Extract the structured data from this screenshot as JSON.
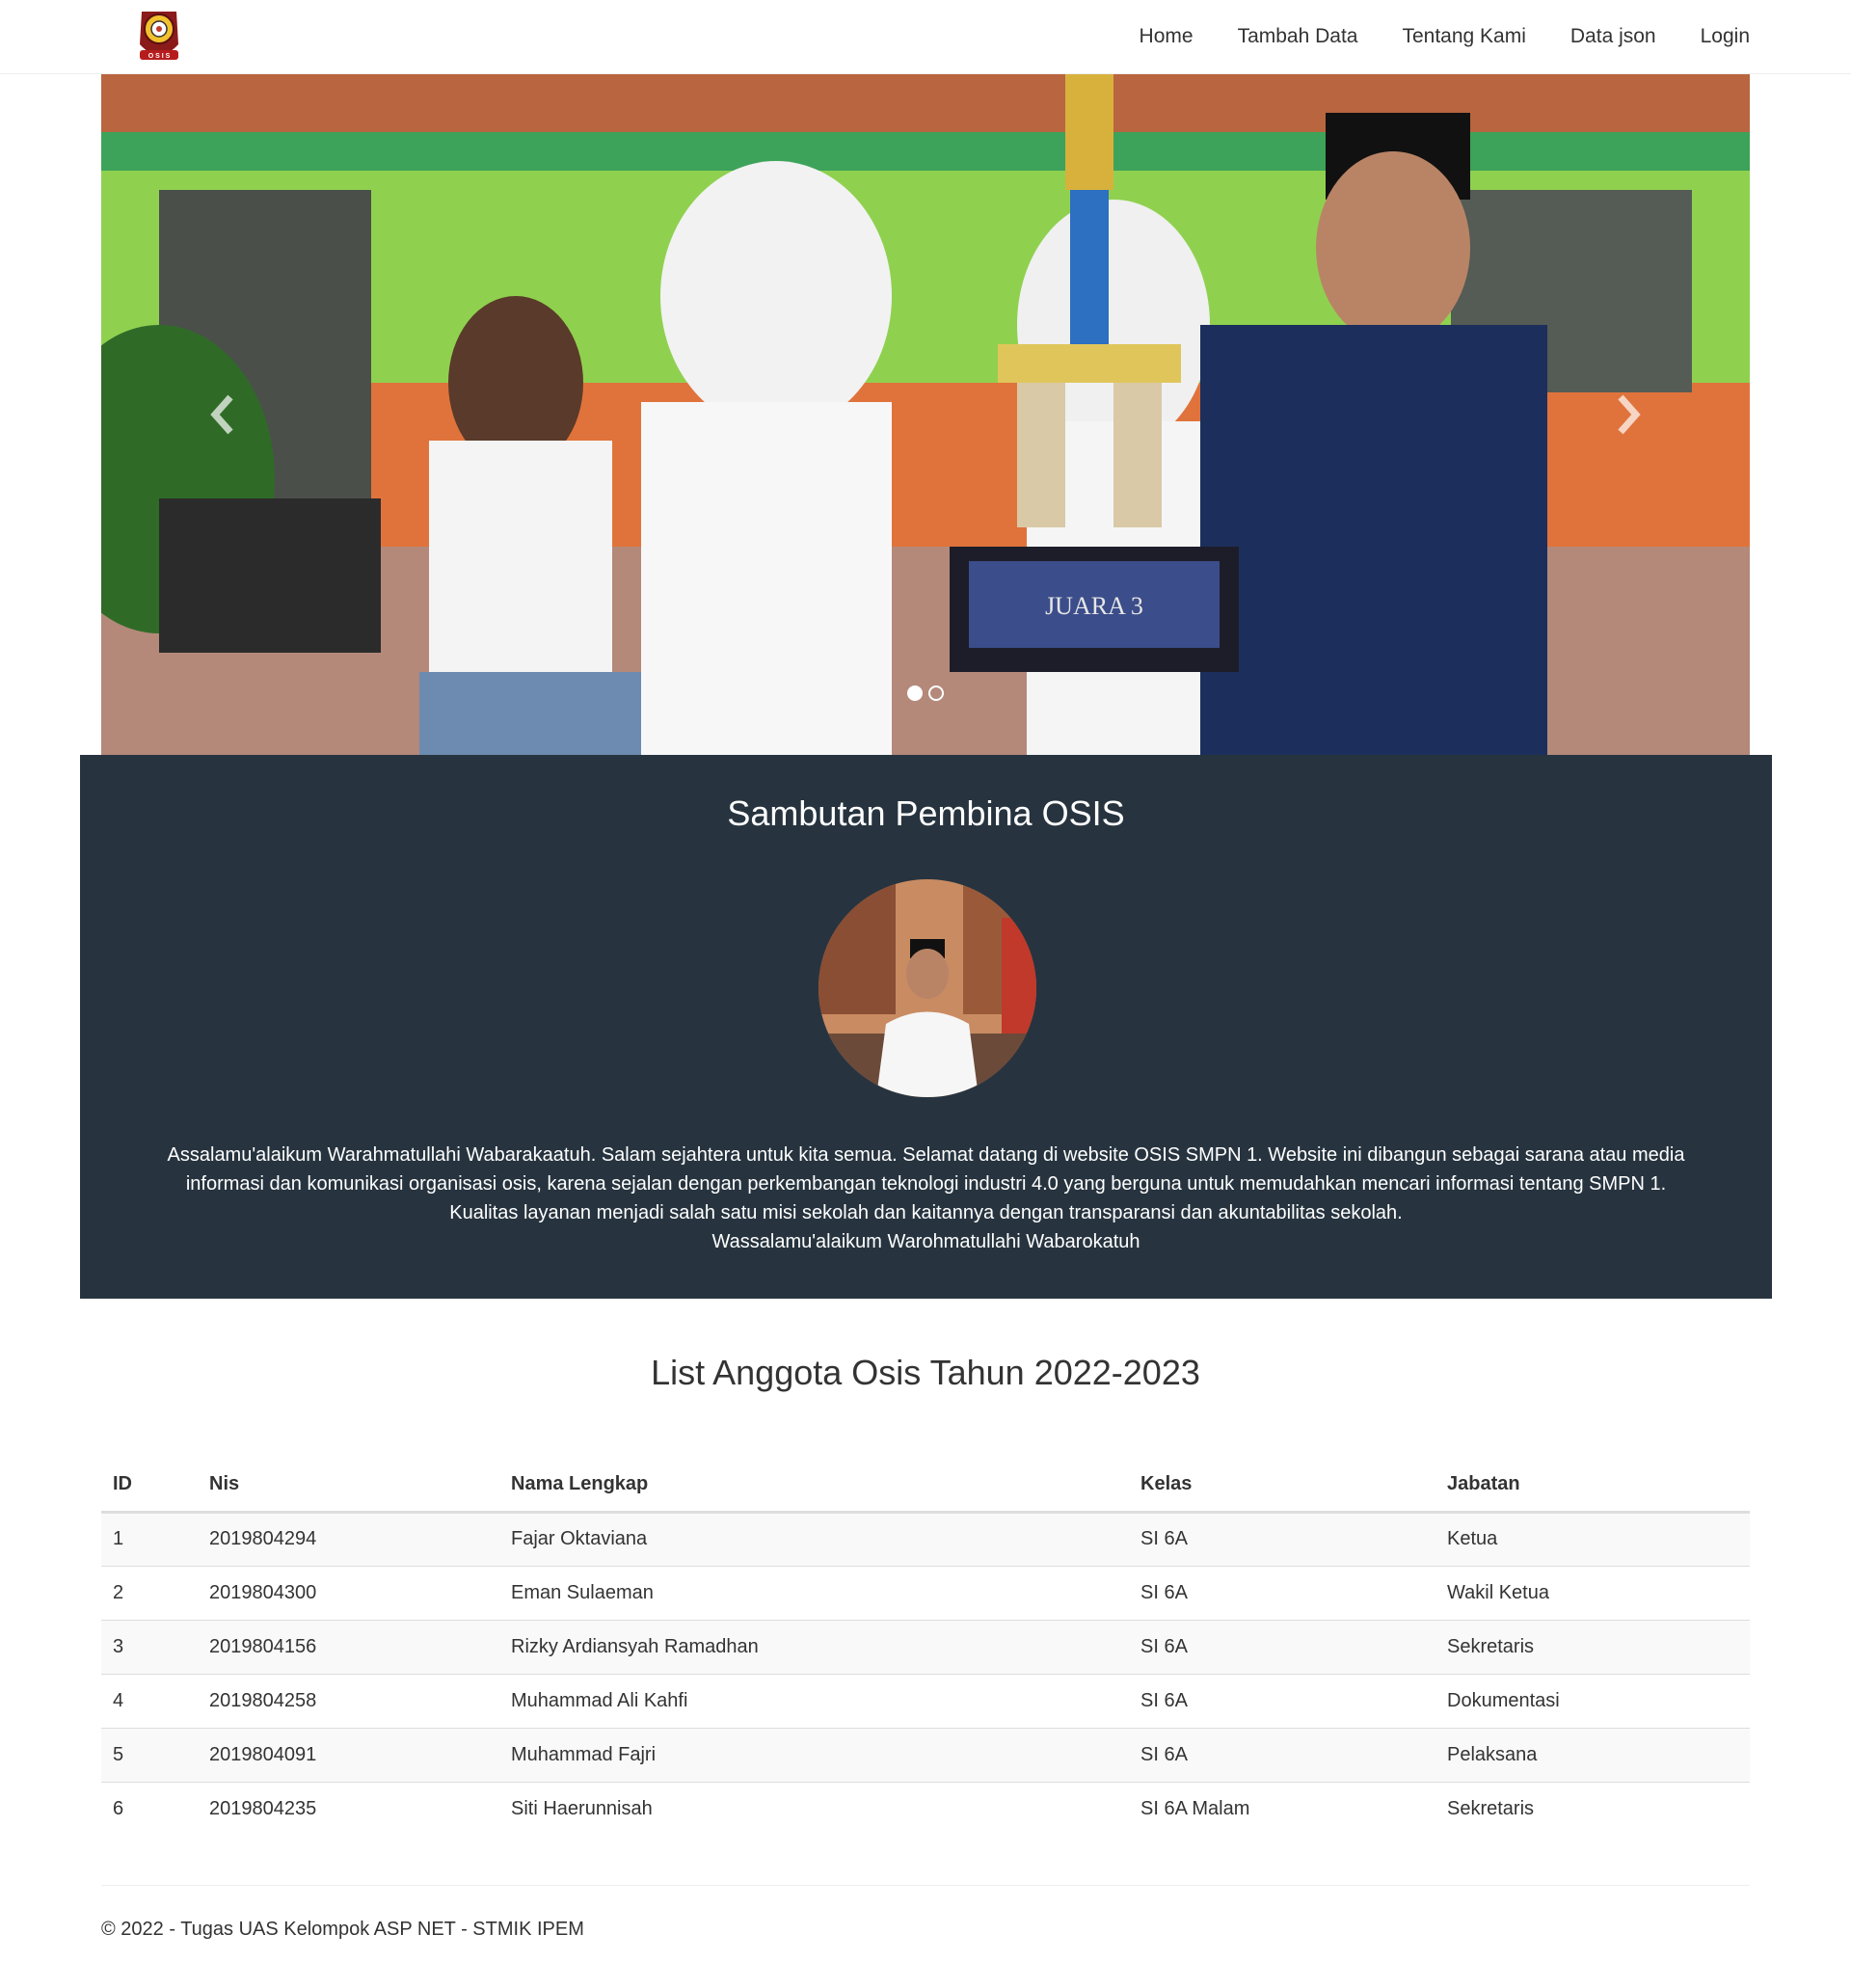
{
  "nav": {
    "brand_icon": "osis-logo-icon",
    "items": [
      "Home",
      "Tambah Data",
      "Tentang Kami",
      "Data json",
      "Login"
    ]
  },
  "carousel": {
    "slide_count": 2,
    "active_index": 0,
    "trophy_text": "JUARA 3"
  },
  "welcome": {
    "title": "Sambutan Pembina OSIS",
    "paragraph": "Assalamu'alaikum Warahmatullahi Wabarakaatuh. Salam sejahtera untuk kita semua. Selamat datang di website OSIS SMPN 1. Website ini dibangun sebagai sarana atau media informasi dan komunikasi organisasi osis, karena sejalan dengan perkembangan teknologi industri 4.0 yang berguna untuk memudahkan mencari informasi tentang SMPN 1. Kualitas layanan menjadi salah satu misi sekolah dan kaitannya dengan transparansi dan akuntabilitas sekolah.",
    "closing": "Wassalamu'alaikum Warohmatullahi Wabarokatuh"
  },
  "members": {
    "title": "List Anggota Osis Tahun 2022-2023",
    "columns": [
      "ID",
      "Nis",
      "Nama Lengkap",
      "Kelas",
      "Jabatan"
    ],
    "rows": [
      [
        "1",
        "2019804294",
        "Fajar Oktaviana",
        "SI 6A",
        "Ketua"
      ],
      [
        "2",
        "2019804300",
        "Eman Sulaeman",
        "SI 6A",
        "Wakil Ketua"
      ],
      [
        "3",
        "2019804156",
        "Rizky Ardiansyah Ramadhan",
        "SI 6A",
        "Sekretaris"
      ],
      [
        "4",
        "2019804258",
        "Muhammad Ali Kahfi",
        "SI 6A",
        "Dokumentasi"
      ],
      [
        "5",
        "2019804091",
        "Muhammad Fajri",
        "SI 6A",
        "Pelaksana"
      ],
      [
        "6",
        "2019804235",
        "Siti Haerunnisah",
        "SI 6A Malam",
        "Sekretaris"
      ]
    ]
  },
  "footer": {
    "text": "© 2022 - Tugas UAS Kelompok ASP NET - STMIK IPEM"
  }
}
